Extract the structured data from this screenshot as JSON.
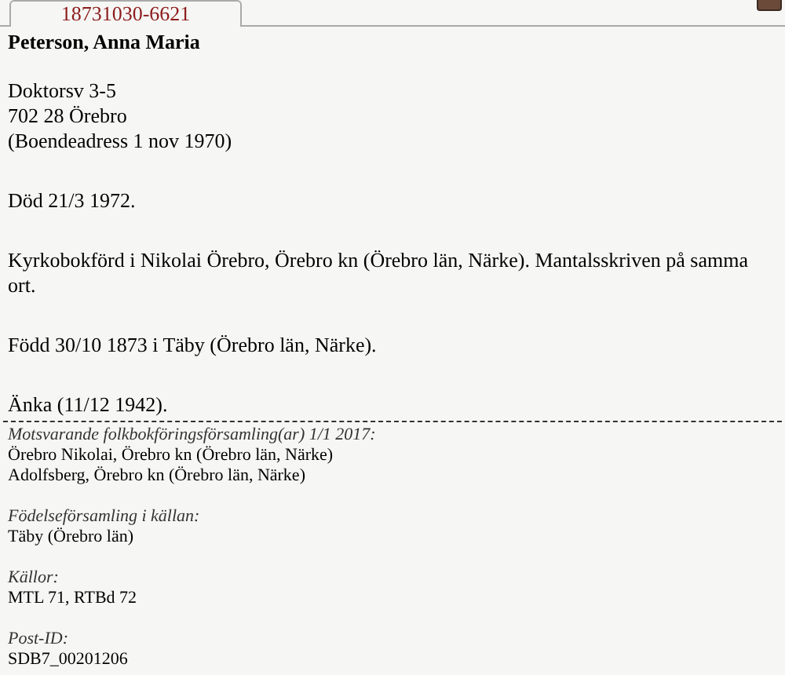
{
  "tab": {
    "label": "18731030-6621",
    "selected": true
  },
  "name": "Peterson, Anna Maria",
  "address": [
    "Doktorsv 3-5",
    "702 28 Örebro",
    "(Boendeadress 1 nov 1970)"
  ],
  "paragraphs": [
    "Död 21/3 1972.",
    "Kyrkobokförd i Nikolai Örebro, Örebro kn (Örebro län, Närke). Mantalsskriven på samma ort.",
    "Född 30/10 1873 i Täby (Örebro län, Närke).",
    "Änka (11/12 1942)."
  ],
  "sections": [
    {
      "heading": "Motsvarande folkbokföringsförsamling(ar) 1/1 2017:",
      "lines": [
        "Örebro Nikolai, Örebro kn (Örebro län, Närke)",
        "Adolfsberg, Örebro kn (Örebro län, Närke)"
      ]
    },
    {
      "heading": "Födelseförsamling i källan:",
      "lines": [
        "Täby (Örebro län)"
      ]
    },
    {
      "heading": "Källor:",
      "lines": [
        "MTL 71, RTBd 72"
      ]
    },
    {
      "heading": "Post-ID:",
      "lines": [
        "SDB7_00201206"
      ]
    }
  ]
}
